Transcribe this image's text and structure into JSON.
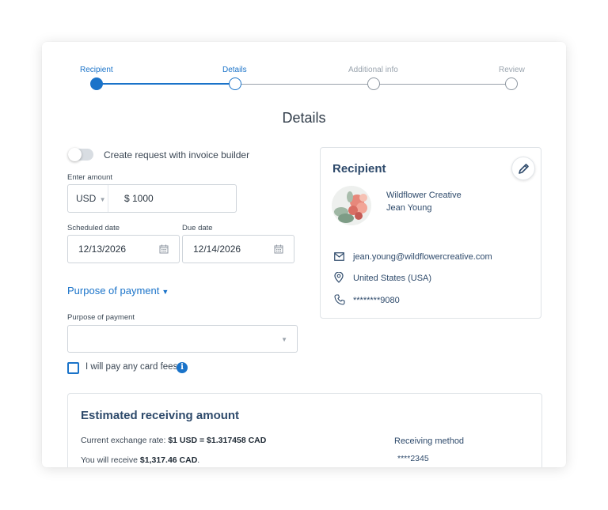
{
  "stepper": {
    "steps": [
      {
        "label": "Recipient",
        "state": "complete"
      },
      {
        "label": "Details",
        "state": "current"
      },
      {
        "label": "Additional info",
        "state": "upcoming"
      },
      {
        "label": "Review",
        "state": "upcoming"
      }
    ]
  },
  "page_title": "Details",
  "invoice_toggle": {
    "label": "Create request with invoice builder",
    "on": false
  },
  "amount": {
    "label": "Enter amount",
    "currency": "USD",
    "value": "$ 1000"
  },
  "scheduled_date": {
    "label": "Scheduled date",
    "value": "12/13/2026"
  },
  "due_date": {
    "label": "Due date",
    "value": "12/14/2026"
  },
  "purpose": {
    "link_label": "Purpose of payment",
    "select_label": "Purpose of payment",
    "select_value": ""
  },
  "card_fees": {
    "label": "I will pay any card fees",
    "checked": false
  },
  "recipient": {
    "title": "Recipient",
    "company": "Wildflower Creative",
    "person": "Jean Young",
    "email": "jean.young@wildflowercreative.com",
    "country": "United States (USA)",
    "phone": "********9080"
  },
  "estimate": {
    "title": "Estimated receiving amount",
    "rate_prefix": "Current exchange rate: ",
    "rate_value": "$1 USD = $1.317458 CAD",
    "receive_prefix": "You will receive ",
    "receive_value": "$1,317.46 CAD",
    "receive_suffix": ".",
    "method_label": "Receiving method",
    "method_value": "****2345"
  },
  "colors": {
    "accent": "#1a73c9",
    "heading": "#2e4a6b",
    "muted_line": "#8d96a0"
  }
}
